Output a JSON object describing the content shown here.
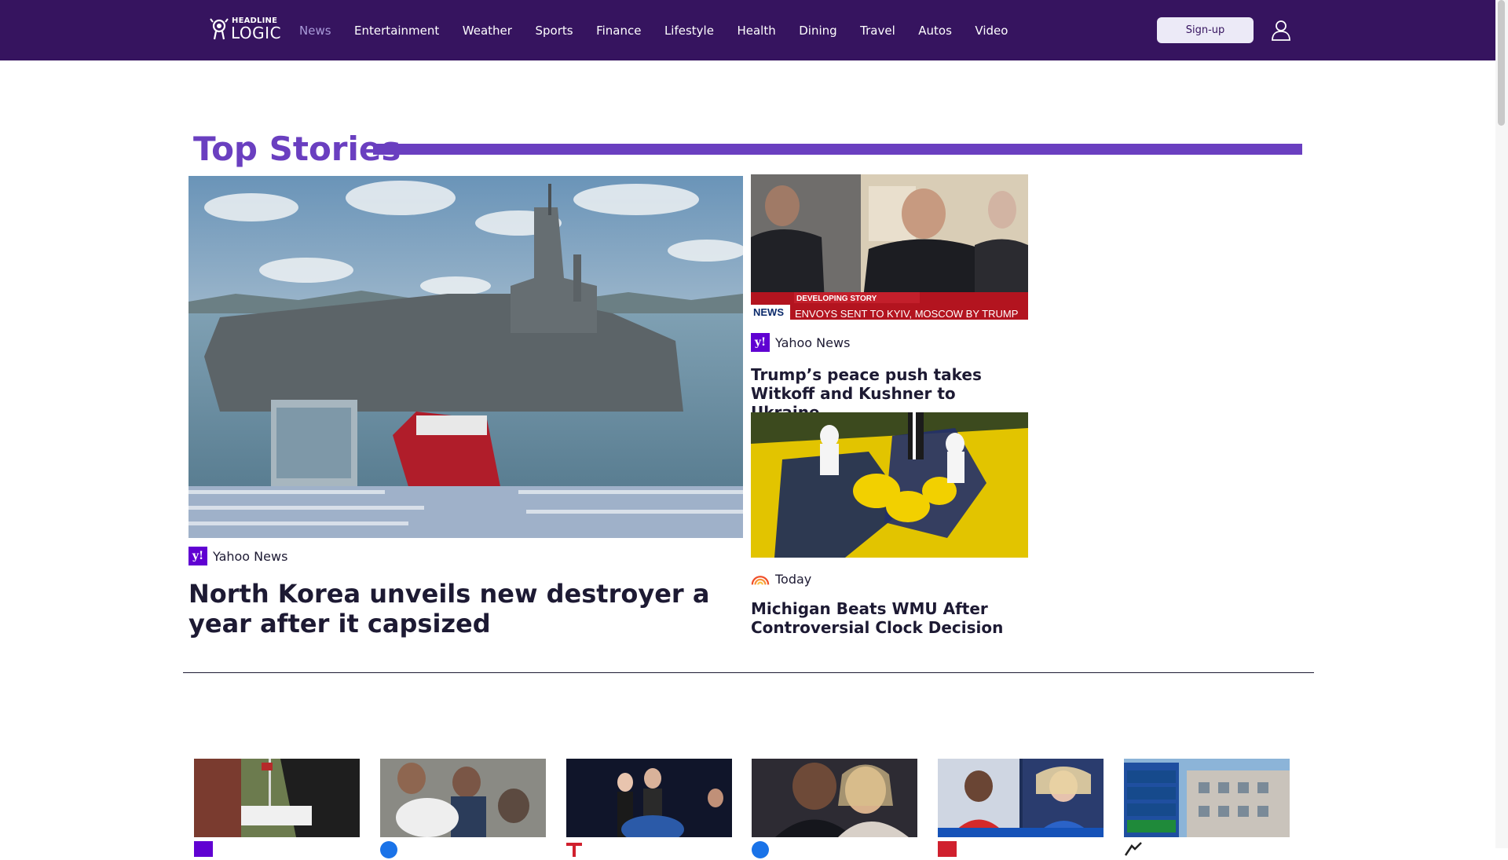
{
  "header": {
    "logo_text_top": "HEADLINE",
    "logo_text_bottom": "LOGIC",
    "nav": [
      {
        "label": "News",
        "active": true
      },
      {
        "label": "Entertainment"
      },
      {
        "label": "Weather"
      },
      {
        "label": "Sports"
      },
      {
        "label": "Finance"
      },
      {
        "label": "Lifestyle"
      },
      {
        "label": "Health"
      },
      {
        "label": "Dining"
      },
      {
        "label": "Travel"
      },
      {
        "label": "Autos"
      },
      {
        "label": "Video"
      }
    ],
    "signup_label": "Sign-up",
    "user_icon": "user-icon"
  },
  "top_stories": {
    "title": "Top Stories",
    "hero": {
      "source": "Yahoo News",
      "headline": "North Korea unveils new destroyer a year after it capsized"
    },
    "side": [
      {
        "source": "Yahoo News",
        "headline": "Trump’s peace push takes Witkoff and Kushner to Ukraine",
        "image_caption_tag": "DEVELOPING STORY",
        "image_caption": "ENVOYS SENT TO KYIV, MOSCOW BY TRUMP",
        "image_badge": "NEWS"
      },
      {
        "source": "Today",
        "headline": "Michigan Beats WMU After Controversial Clock Decision"
      }
    ]
  },
  "colors": {
    "header_bg": "#36145f",
    "accent": "#6a3fc0",
    "nav_active": "#a99bd9",
    "yahoo": "#6001d2",
    "text": "#1d1a33"
  }
}
